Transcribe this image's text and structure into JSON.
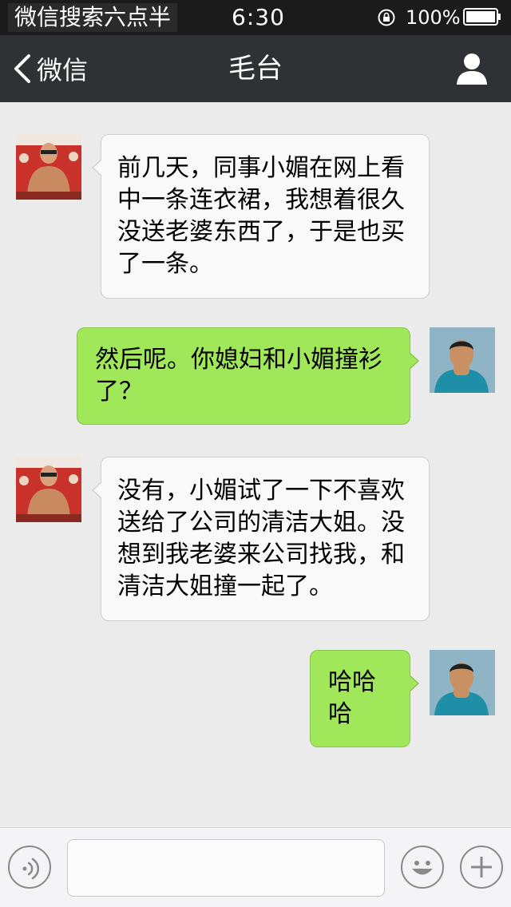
{
  "status_bar": {
    "carrier": "微信搜索六点半",
    "time": "6:30",
    "battery_percent": "100%"
  },
  "nav": {
    "back_label": "微信",
    "title": "毛台"
  },
  "messages": [
    {
      "side": "left",
      "text": "前几天，同事小媚在网上看中一条连衣裙，我想着很久没送老婆东西了，于是也买了一条。"
    },
    {
      "side": "right",
      "text": "然后呢。你媳妇和小媚撞衫了？"
    },
    {
      "side": "left",
      "text": "没有，小媚试了一下不喜欢送给了公司的清洁大姐。没想到我老婆来公司找我，和清洁大姐撞一起了。"
    },
    {
      "side": "right",
      "text": "哈哈哈"
    }
  ],
  "input_bar": {
    "message_value": "",
    "icons": [
      "voice-icon",
      "emoji-icon",
      "plus-icon"
    ]
  },
  "colors": {
    "status_bar_bg": "#1b1b1b",
    "nav_bar_bg": "#2f3134",
    "chat_bg": "#ebebeb",
    "received_bubble": "#f9f9f9",
    "sent_bubble": "#a0e75a"
  }
}
